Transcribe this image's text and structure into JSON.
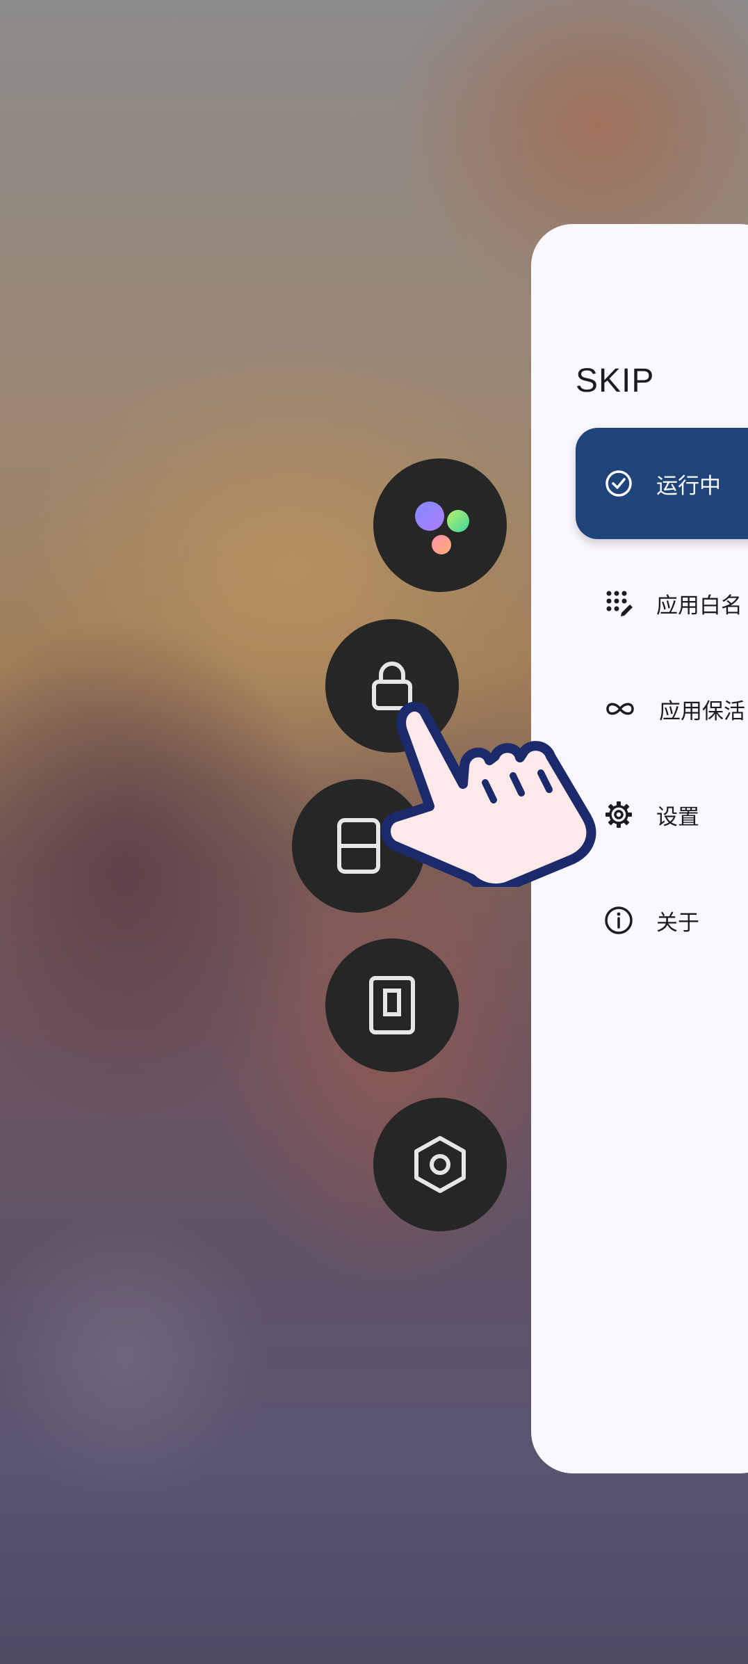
{
  "panel": {
    "title": "SKIP",
    "items": [
      {
        "label": "运行中",
        "icon": "check-circle-icon",
        "active": true
      },
      {
        "label": "应用白名",
        "icon": "apps-edit-icon",
        "active": false
      },
      {
        "label": "应用保活",
        "icon": "infinity-icon",
        "active": false
      },
      {
        "label": "设置",
        "icon": "gear-icon",
        "active": false
      },
      {
        "label": "关于",
        "icon": "info-icon",
        "active": false
      }
    ]
  },
  "floating_buttons": [
    {
      "icon": "colorful-dots-icon"
    },
    {
      "icon": "lock-icon"
    },
    {
      "icon": "split-screen-icon"
    },
    {
      "icon": "small-window-icon"
    },
    {
      "icon": "hexagon-settings-icon"
    }
  ],
  "colors": {
    "panel_background": "#fbf8fd",
    "active_item": "#1f4479",
    "fab_background": "#262627",
    "hand_outline": "#1b2a6b",
    "hand_fill": "#fde9ea"
  }
}
